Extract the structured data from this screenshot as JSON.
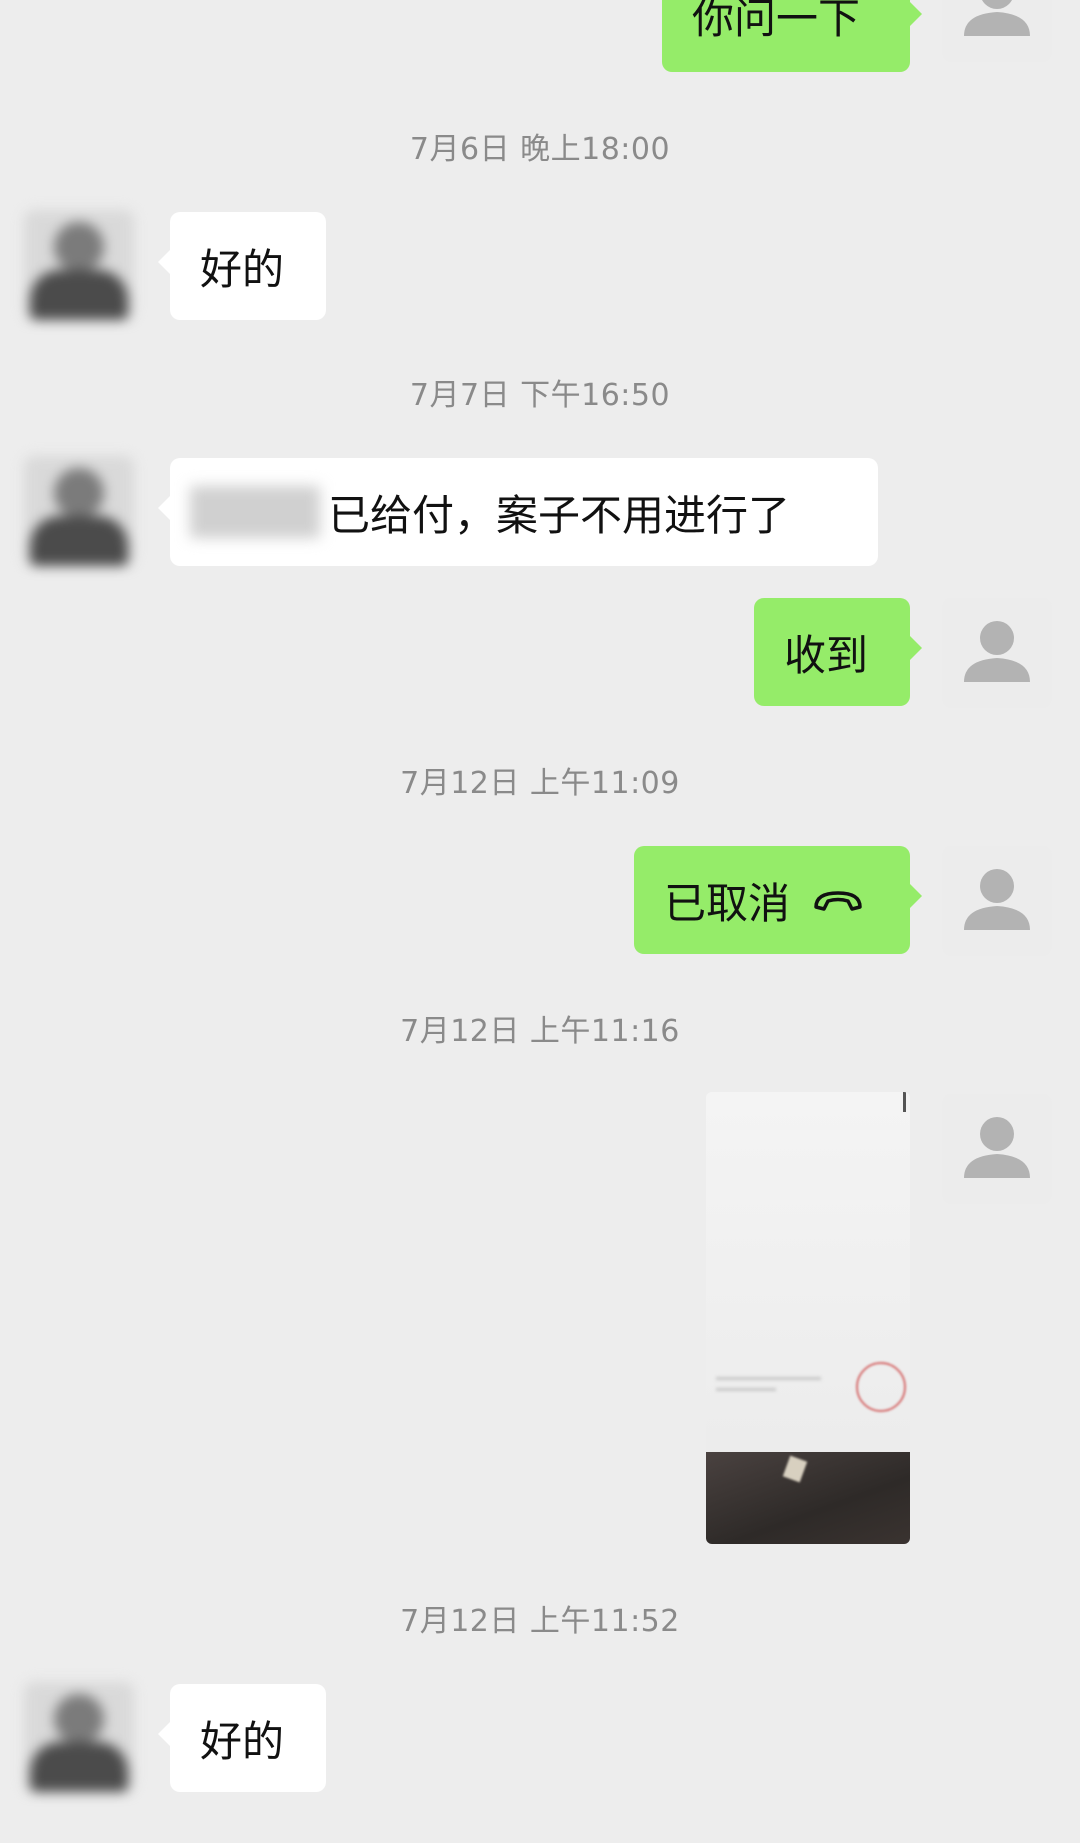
{
  "messages": {
    "m0_text": "你问一下",
    "t1": "7月6日 晚上18:00",
    "m1_text": "好的",
    "t2": "7月7日 下午16:50",
    "m2_text": "已给付，案子不用进行了",
    "m3_text": "收到",
    "t3": "7月12日 上午11:09",
    "m4_text": "已取消",
    "t4": "7月12日 上午11:16",
    "t5": "7月12日 上午11:52",
    "m6_text": "好的"
  },
  "icons": {
    "call": "phone-hangup-icon",
    "avatar_default": "default-avatar-icon"
  },
  "colors": {
    "background": "#ededed",
    "outgoing_bubble": "#95ec69",
    "incoming_bubble": "#ffffff",
    "timestamp": "#8a8a8a"
  }
}
